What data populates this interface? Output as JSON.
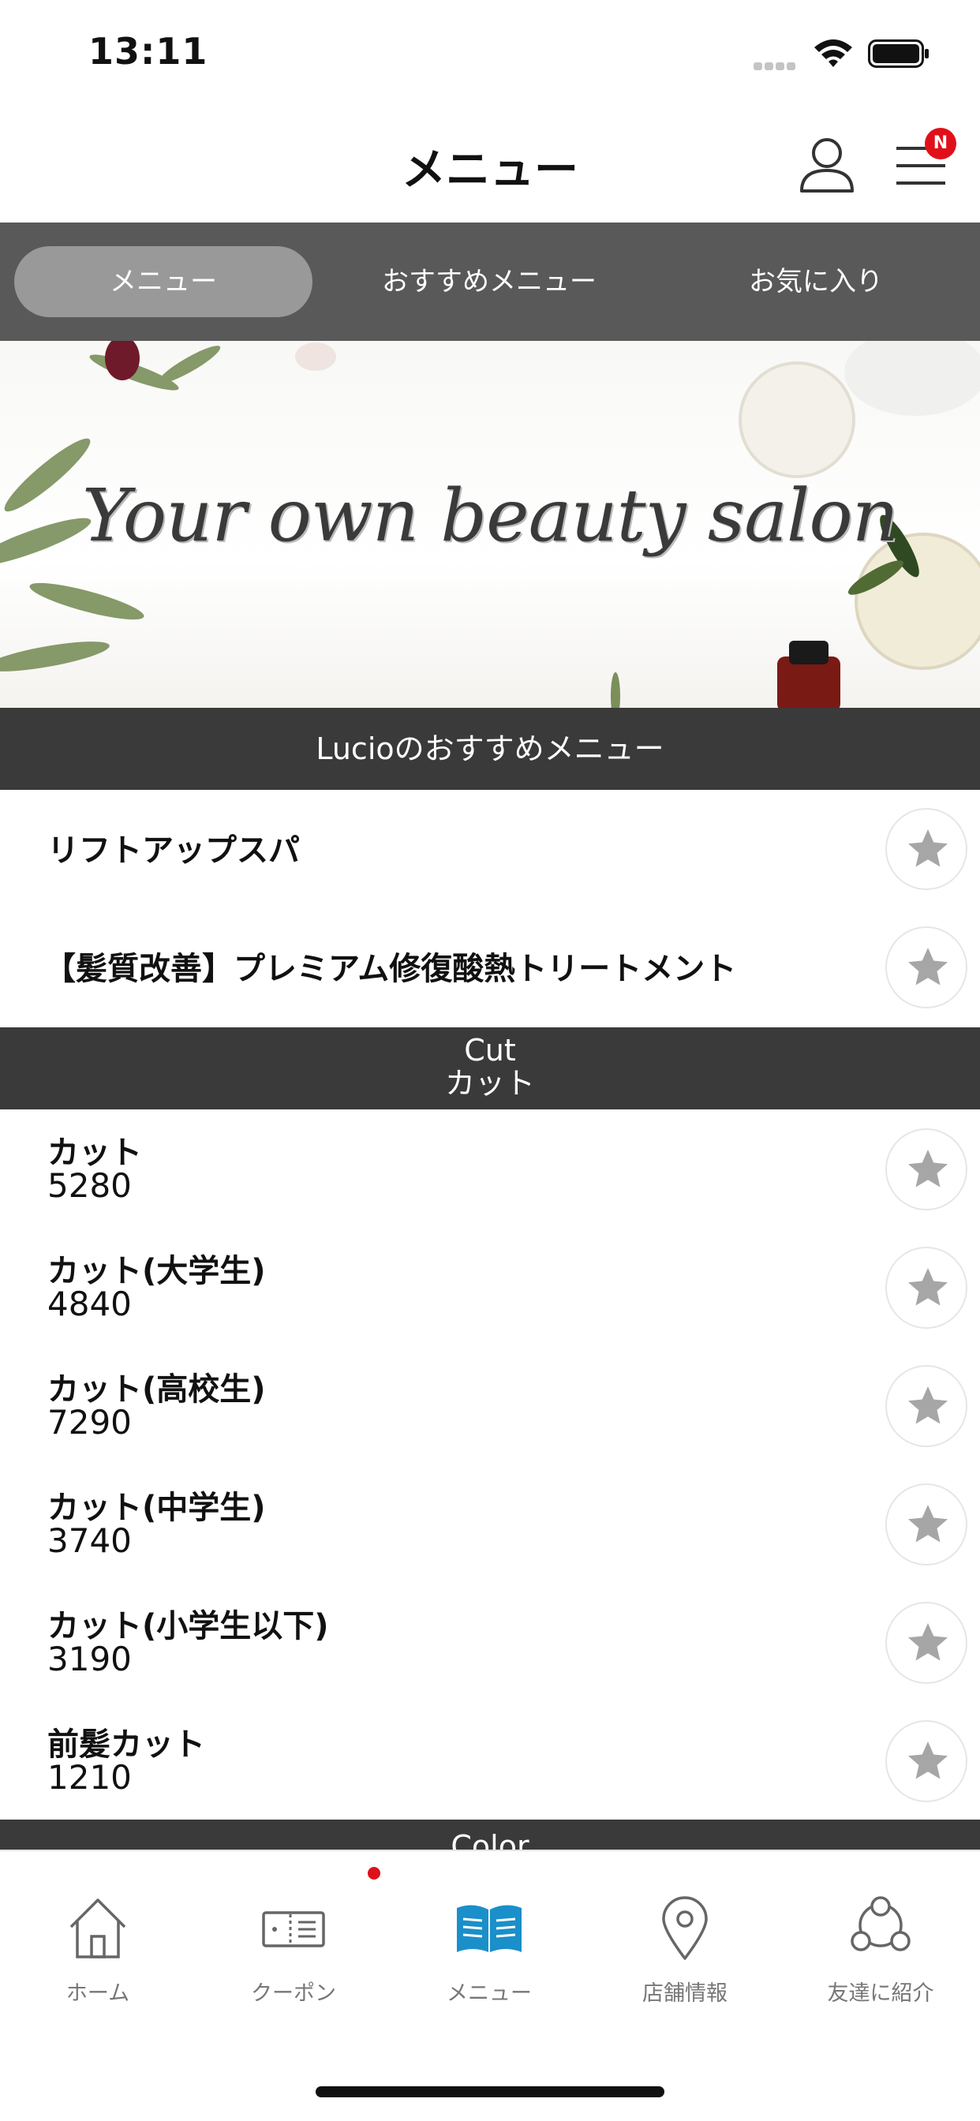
{
  "status_bar": {
    "time": "13:11"
  },
  "nav": {
    "title": "メニュー",
    "badge": "N"
  },
  "tabs": [
    {
      "label": "メニュー",
      "active": true
    },
    {
      "label": "おすすめメニュー",
      "active": false
    },
    {
      "label": "お気に入り",
      "active": false
    }
  ],
  "banner": {
    "text": "Your own beauty salon"
  },
  "sections": [
    {
      "title": "Lucioのおすすめメニュー",
      "items": [
        {
          "name": "リフトアップスパ"
        },
        {
          "name": "【髪質改善】プレミアム修復酸熱トリートメント"
        }
      ]
    },
    {
      "title_en": "Cut",
      "title_ja": "カット",
      "items": [
        {
          "name": "カット",
          "price": "5280"
        },
        {
          "name": "カット(大学生)",
          "price": "4840"
        },
        {
          "name": "カット(高校生)",
          "price": "7290"
        },
        {
          "name": "カット(中学生)",
          "price": "3740"
        },
        {
          "name": "カット(小学生以下)",
          "price": "3190"
        },
        {
          "name": "前髪カット",
          "price": "1210"
        }
      ]
    },
    {
      "title_en": "Color"
    }
  ],
  "tabbar": [
    {
      "label": "ホーム",
      "icon": "home-icon"
    },
    {
      "label": "クーポン",
      "icon": "coupon-icon"
    },
    {
      "label": "メニュー",
      "icon": "menu-book-icon",
      "active": true
    },
    {
      "label": "店舗情報",
      "icon": "location-pin-icon"
    },
    {
      "label": "友達に紹介",
      "icon": "share-friends-icon"
    }
  ],
  "colors": {
    "tab_bar_bg": "#595959",
    "section_header_bg": "#3a3a3a",
    "active_tab_icon": "#1a8fc9",
    "badge": "#e0101a",
    "star": "#a6a6a6"
  }
}
